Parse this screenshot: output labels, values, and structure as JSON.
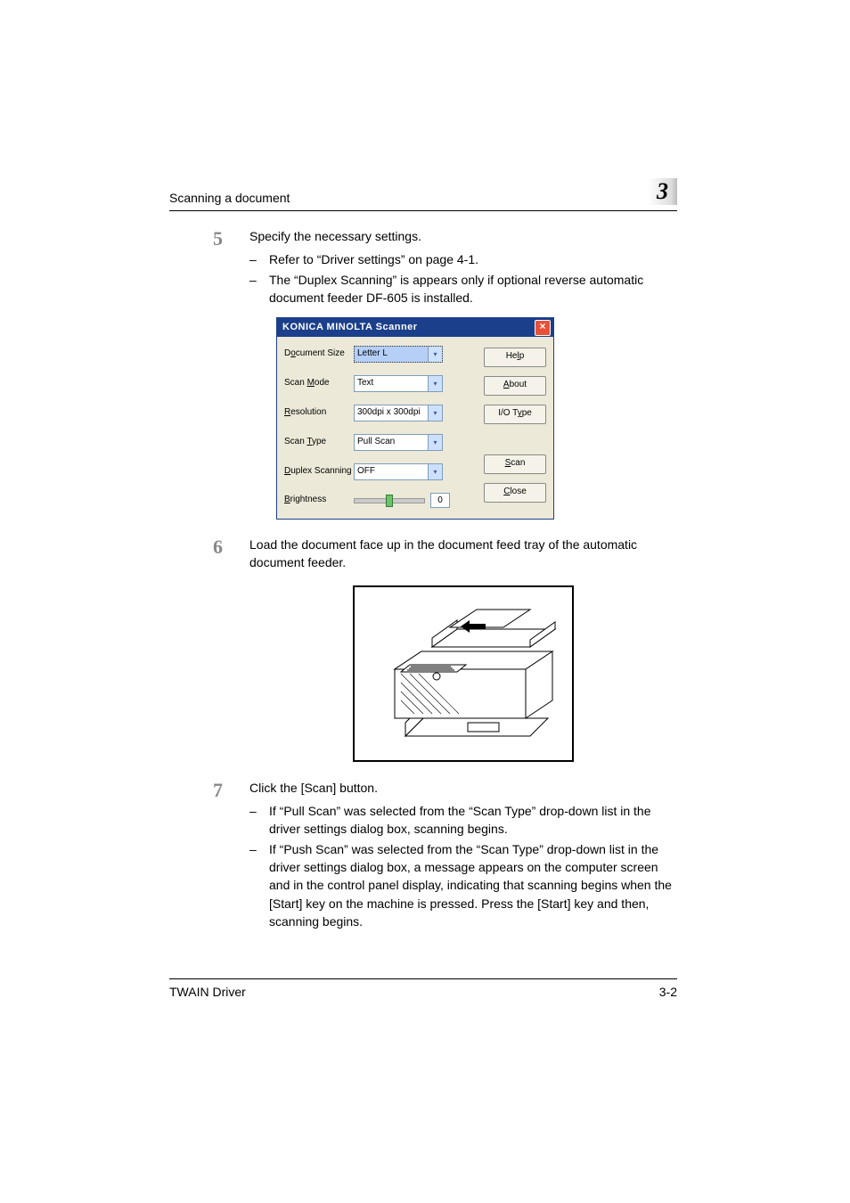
{
  "header": {
    "section": "Scanning a document",
    "chapter": "3"
  },
  "step5": {
    "num": "5",
    "lead": "Specify the necessary settings.",
    "b1": "Refer to “Driver settings” on page 4-1.",
    "b2": "The “Duplex Scanning” is appears only if optional reverse automatic document feeder DF-605 is installed."
  },
  "dialog": {
    "title": "KONICA MINOLTA      Scanner",
    "close_glyph": "×",
    "labels": {
      "doc": "Document Size",
      "mode": "Scan Mode",
      "res": "Resolution",
      "type": "Scan Type",
      "duplex": "Duplex Scanning",
      "bright": "Brightness"
    },
    "values": {
      "doc": "Letter L",
      "mode": "Text",
      "res": "300dpi x 300dpi",
      "type": "Pull Scan",
      "duplex": "OFF",
      "bright": "0"
    },
    "buttons": {
      "help": "Help",
      "about": "About",
      "io": "I/O Type",
      "scan": "Scan",
      "close": "Close"
    }
  },
  "step6": {
    "num": "6",
    "lead": "Load the document face up in the document feed tray of the automatic document feeder."
  },
  "step7": {
    "num": "7",
    "lead": "Click the [Scan] button.",
    "b1": "If “Pull Scan” was selected from the “Scan Type” drop-down list in the driver settings dialog box, scanning begins.",
    "b2": "If “Push Scan” was selected from the “Scan Type” drop-down list in the driver settings dialog box, a message appears on the computer screen and in the control panel display, indicating that scanning begins when the [Start] key on the machine is pressed. Press the [Start] key and then, scanning begins."
  },
  "footer": {
    "left": "TWAIN Driver",
    "right": "3-2"
  }
}
